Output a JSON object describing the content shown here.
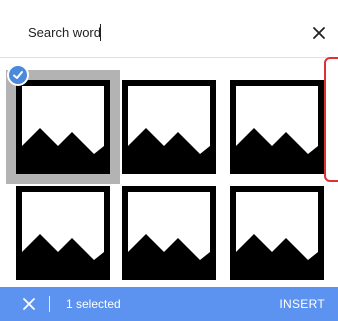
{
  "search": {
    "value": "Search word",
    "close_icon": "close-icon"
  },
  "grid": {
    "items": [
      {
        "icon": "image-placeholder-icon",
        "selected": true
      },
      {
        "icon": "image-placeholder-icon",
        "selected": false
      },
      {
        "icon": "image-placeholder-icon",
        "selected": false
      },
      {
        "icon": "image-placeholder-icon",
        "selected": false
      },
      {
        "icon": "image-placeholder-icon",
        "selected": false
      },
      {
        "icon": "image-placeholder-icon",
        "selected": false
      }
    ]
  },
  "bottom_bar": {
    "selected_label": "1 selected",
    "insert_label": "INSERT",
    "deselect_icon": "close-icon"
  },
  "colors": {
    "accent": "#5c93f0",
    "check": "#4a89dc",
    "highlight": "#e03131",
    "selected_bg": "#b3b3b3"
  }
}
